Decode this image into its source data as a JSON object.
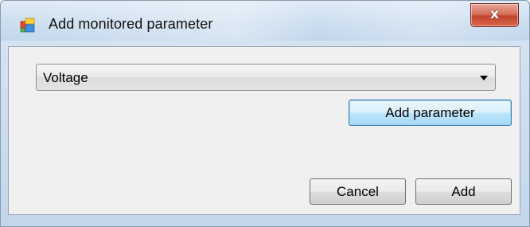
{
  "window": {
    "title": "Add monitored parameter",
    "close_glyph": "x",
    "icon": "application-icon"
  },
  "combo": {
    "selected_value": "Voltage",
    "arrow_icon": "dropdown-arrow-icon"
  },
  "buttons": {
    "add_parameter": "Add parameter",
    "cancel": "Cancel",
    "add": "Add"
  }
}
